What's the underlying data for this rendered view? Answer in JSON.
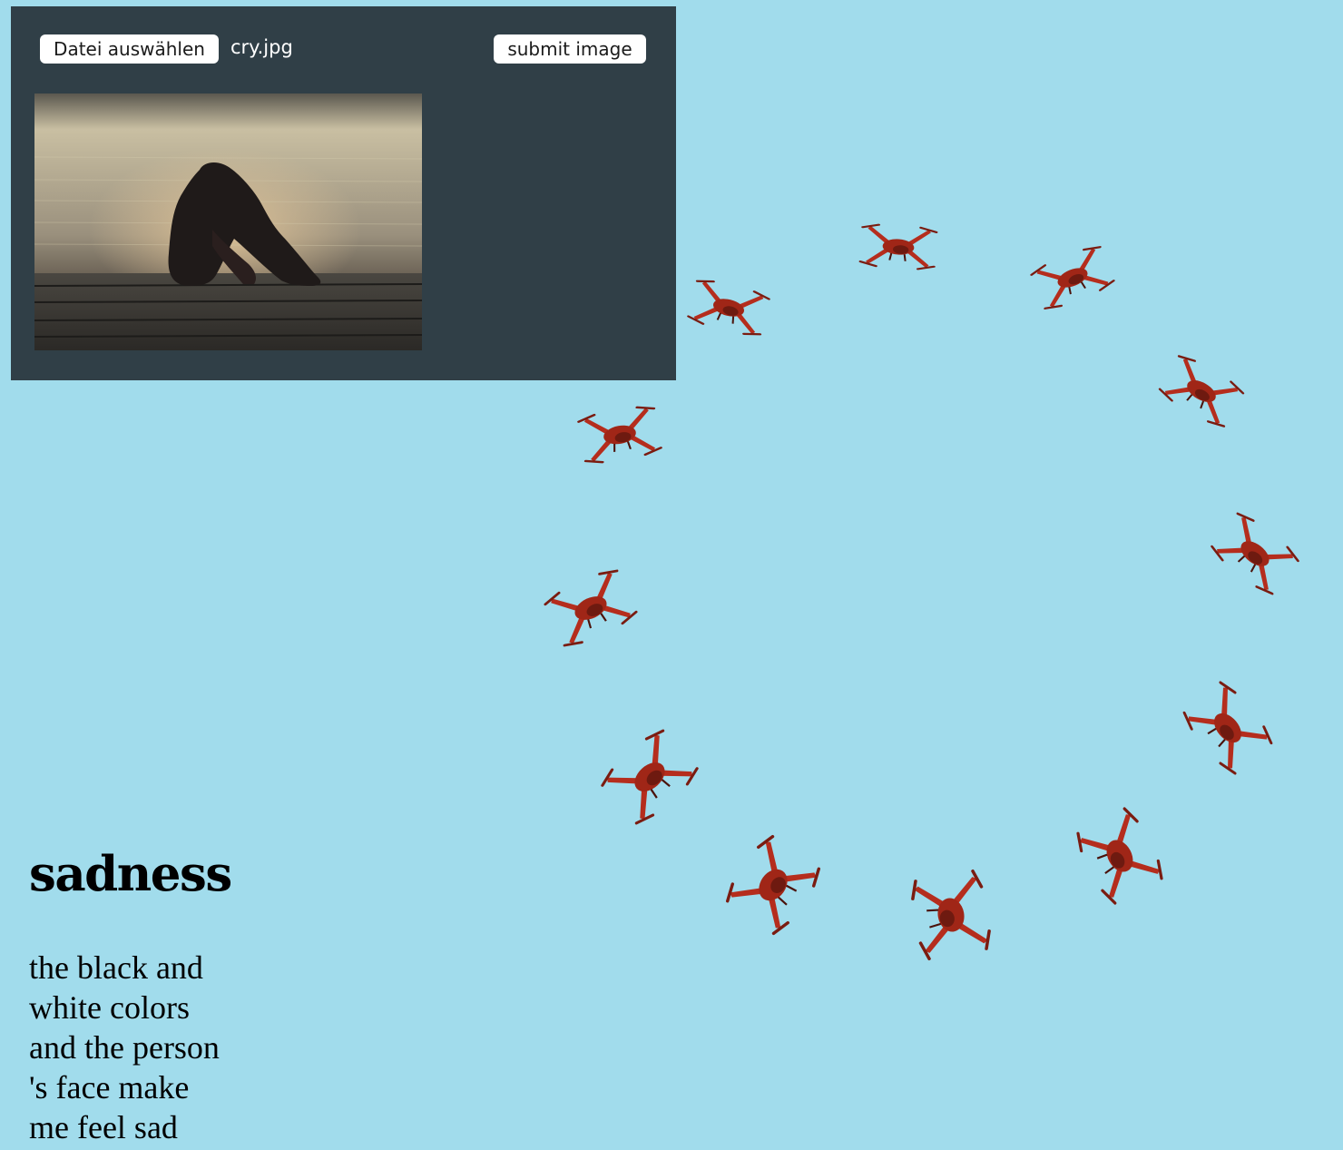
{
  "upload": {
    "choose_file_label": "Datei auswählen",
    "file_name": "cry.jpg",
    "submit_label": "submit image"
  },
  "result": {
    "emotion": "sadness",
    "description": "the black and white colors and the person 's face make me feel sad"
  },
  "colors": {
    "page_background": "#a1dcec",
    "panel_background": "#303f47",
    "drone": "#b52d1d"
  },
  "icons": [
    "drone-icon"
  ]
}
